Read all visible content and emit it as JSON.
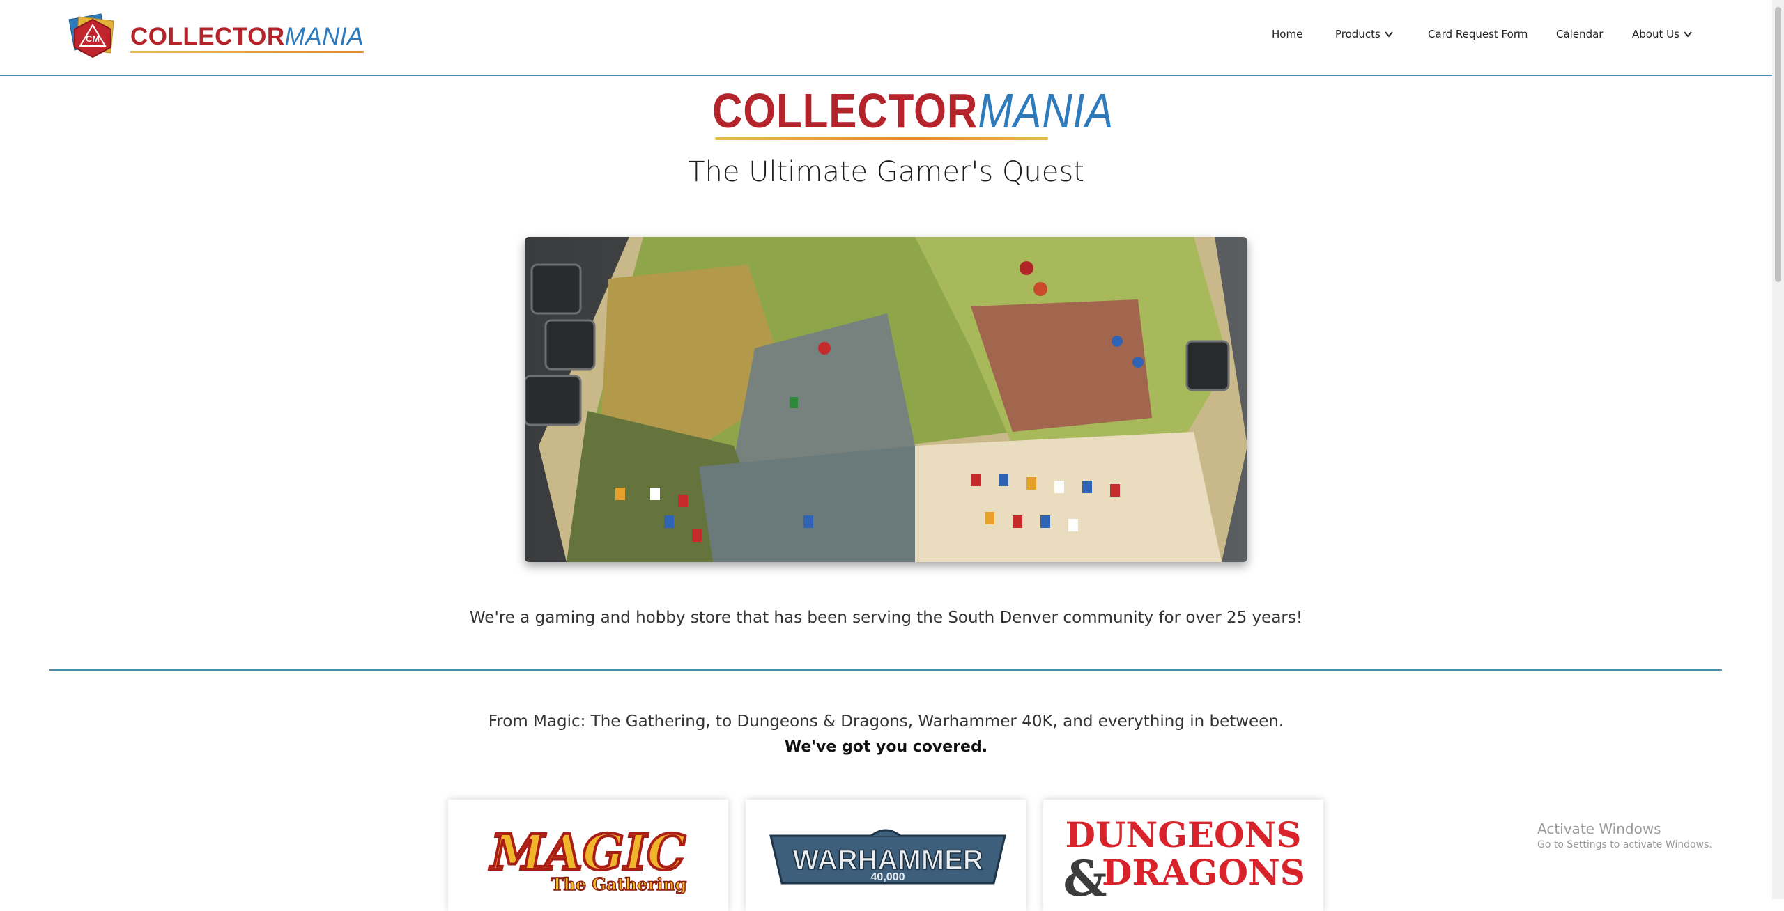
{
  "header": {
    "logo": {
      "word_red": "COLLECTOR",
      "word_blue": "MANIA",
      "icon_text": "CM"
    },
    "nav": [
      {
        "label": "Home",
        "has_dropdown": false
      },
      {
        "label": "Products",
        "has_dropdown": true
      },
      {
        "label": "Card Request Form",
        "has_dropdown": false
      },
      {
        "label": "Calendar",
        "has_dropdown": false
      },
      {
        "label": "About Us",
        "has_dropdown": true
      }
    ]
  },
  "hero": {
    "logo": {
      "word_red": "COLLECTOR",
      "word_blue": "MANIA"
    },
    "tagline": "The Ultimate Gamer's Quest",
    "photo": "board-game-photo"
  },
  "intro": "We're a gaming and hobby store that has been serving the South Denver community for over 25 years!",
  "games": {
    "line": "From Magic: The Gathering, to Dungeons & Dragons, Warhammer 40K, and everything in between.",
    "covered": "We've got you covered.",
    "cards": [
      {
        "logo_main": "MAGIC",
        "logo_sub": "The Gathering"
      },
      {
        "logo_main": "WARHAMMER",
        "logo_sub": "40,000"
      },
      {
        "logo_line1": "DUNGEONS",
        "logo_amp": "&",
        "logo_line2": "DRAGONS"
      }
    ]
  },
  "watermark": {
    "title": "Activate Windows",
    "subtitle": "Go to Settings to activate Windows."
  },
  "colors": {
    "brand_red": "#b5232b",
    "brand_blue": "#2d7bbd",
    "accent_line": "#4a8db0",
    "underline_gold": "#e8b94a"
  }
}
